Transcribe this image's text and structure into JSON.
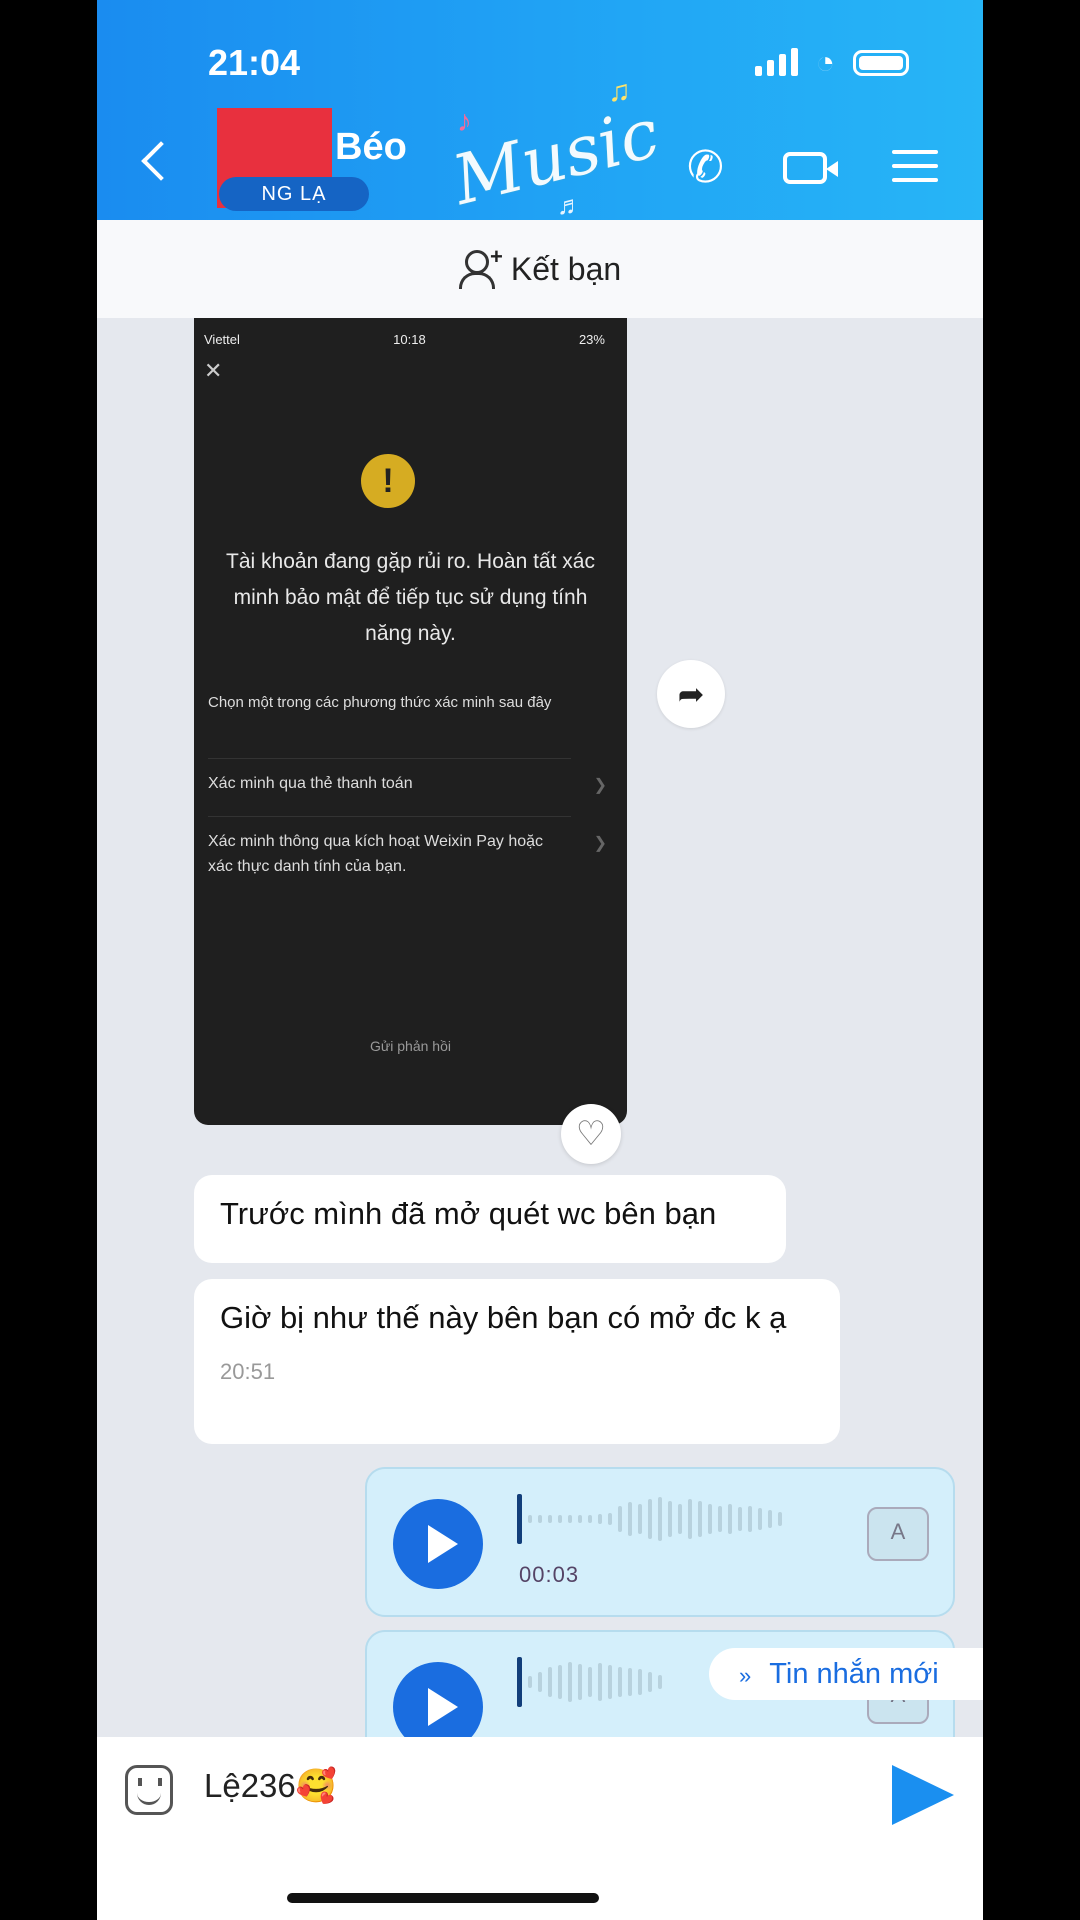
{
  "status_bar": {
    "time": "21:04"
  },
  "header": {
    "contact_name": "Béo",
    "stranger_badge": "NG    LẠ",
    "theme_text": "Music",
    "icons": [
      "back-icon",
      "phone-icon",
      "video-call-icon",
      "menu-icon"
    ]
  },
  "add_friend": {
    "label": "Kết bạn"
  },
  "shared_image": {
    "carrier": "Viettel",
    "time": "10:18",
    "battery": "23%",
    "message": "Tài khoản đang gặp rủi ro. Hoàn tất xác minh bảo mật để tiếp tục sử dụng tính năng này.",
    "choose_text": "Chọn một trong các phương thức xác minh sau đây",
    "options": [
      "Xác minh qua thẻ thanh toán",
      "Xác minh thông qua kích hoạt Weixin Pay hoặc xác thực danh tính của bạn."
    ],
    "feedback": "Gửi phản hồi"
  },
  "messages": [
    {
      "text": "Trước mình đã mở quét wc bên bạn"
    },
    {
      "text": "Giờ bị như thế này bên bạn có mở đc k ạ",
      "time": "20:51"
    }
  ],
  "voice_messages": [
    {
      "duration": "00:03"
    },
    {
      "duration": ""
    }
  ],
  "new_messages_pill": {
    "label": "Tin nhắn mới"
  },
  "composer": {
    "text": "Lệ236🥰"
  }
}
